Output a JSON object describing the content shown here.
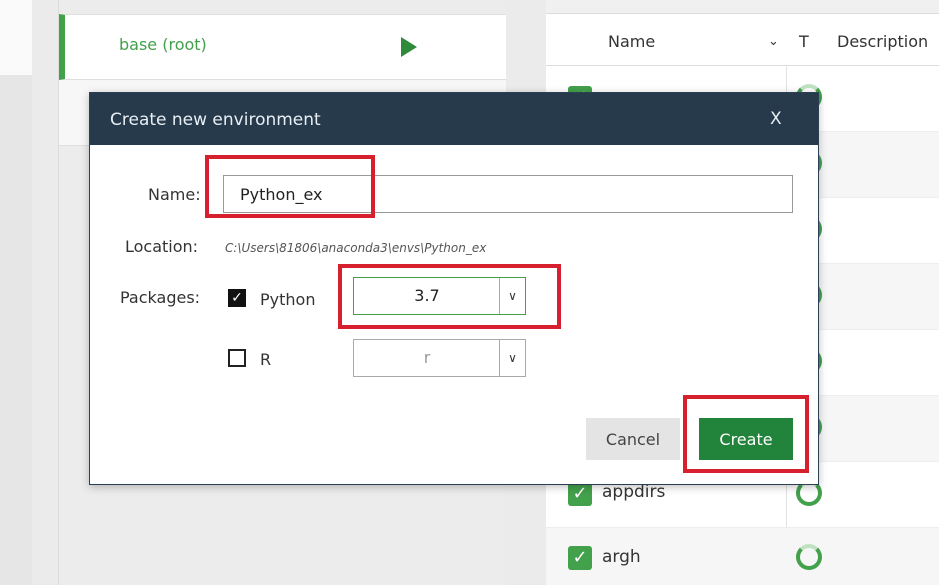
{
  "environments": [
    {
      "name": "base (root)",
      "active": true
    },
    {
      "name": "",
      "active": false
    }
  ],
  "packages_table": {
    "columns": {
      "name": "Name",
      "type": "T",
      "description": "Description"
    },
    "rows": [
      {
        "name": "",
        "checked": true
      },
      {
        "name": "",
        "checked": true
      },
      {
        "name": "",
        "checked": true
      },
      {
        "name": "",
        "checked": true
      },
      {
        "name": "",
        "checked": true
      },
      {
        "name": "",
        "checked": true
      },
      {
        "name": "appdirs",
        "checked": true
      },
      {
        "name": "argh",
        "checked": true
      }
    ]
  },
  "dialog": {
    "title": "Create new environment",
    "close_label": "X",
    "name_label": "Name:",
    "name_value": "Python_ex",
    "location_label": "Location:",
    "location_value": "C:\\Users\\81806\\anaconda3\\envs\\Python_ex",
    "packages_label": "Packages:",
    "python": {
      "label": "Python",
      "checked": true,
      "version": "3.7"
    },
    "r": {
      "label": "R",
      "checked": false,
      "version": "r"
    },
    "cancel_label": "Cancel",
    "create_label": "Create"
  },
  "colors": {
    "accent_green": "#43a04b",
    "create_button": "#22843b",
    "dialog_title_bar": "#263a4b",
    "highlight_red": "#d6202e"
  },
  "icons": [
    "play-icon",
    "chevron-down-icon",
    "checkbox-icon",
    "spinner-icon",
    "close-icon"
  ]
}
